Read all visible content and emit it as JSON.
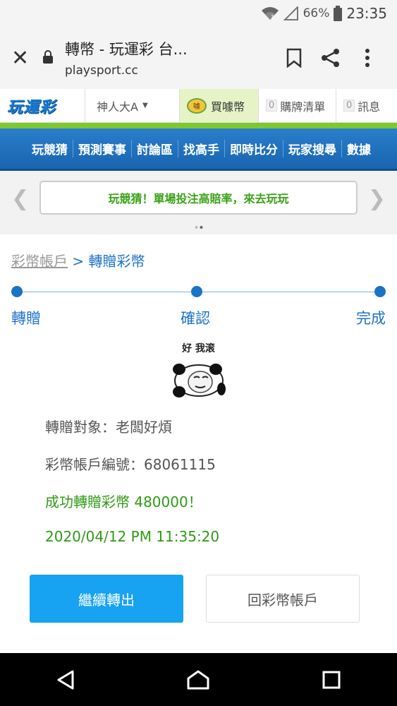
{
  "status": {
    "battery": "66%",
    "time": "23:35"
  },
  "browser": {
    "title": "轉幣 - 玩運彩 台...",
    "url": "playsport.cc"
  },
  "site": {
    "logo": "玩運彩",
    "user": "神人大A",
    "buy": "買噱幣",
    "coin_badge": "噱",
    "bag": {
      "count": "0",
      "label": "購牌清單"
    },
    "msg": {
      "count": "0",
      "label": "訊息"
    }
  },
  "nav": [
    "玩競猜",
    "預測賽事",
    "討論區",
    "找高手",
    "即時比分",
    "玩家搜尋",
    "數據"
  ],
  "promo": {
    "text": "玩競猜！單場投注高賠率，來去玩玩"
  },
  "crumb": {
    "home": "彩幣帳戶",
    "sep": ">",
    "current": "轉贈彩幣"
  },
  "steps": [
    "轉贈",
    "確認",
    "完成"
  ],
  "sticker": {
    "caption": "好 我滚"
  },
  "info": {
    "target": "轉贈對象：老闆好煩",
    "account": "彩幣帳戶編號：68061115",
    "success": "成功轉贈彩幣 480000！",
    "datetime": "2020/04/12 PM 11:35:20"
  },
  "buttons": {
    "continue": "繼續轉出",
    "back": "回彩幣帳戶"
  },
  "colors": {
    "accent": "#1b73c6",
    "success": "#2f9a15",
    "button": "#17a3f1"
  }
}
